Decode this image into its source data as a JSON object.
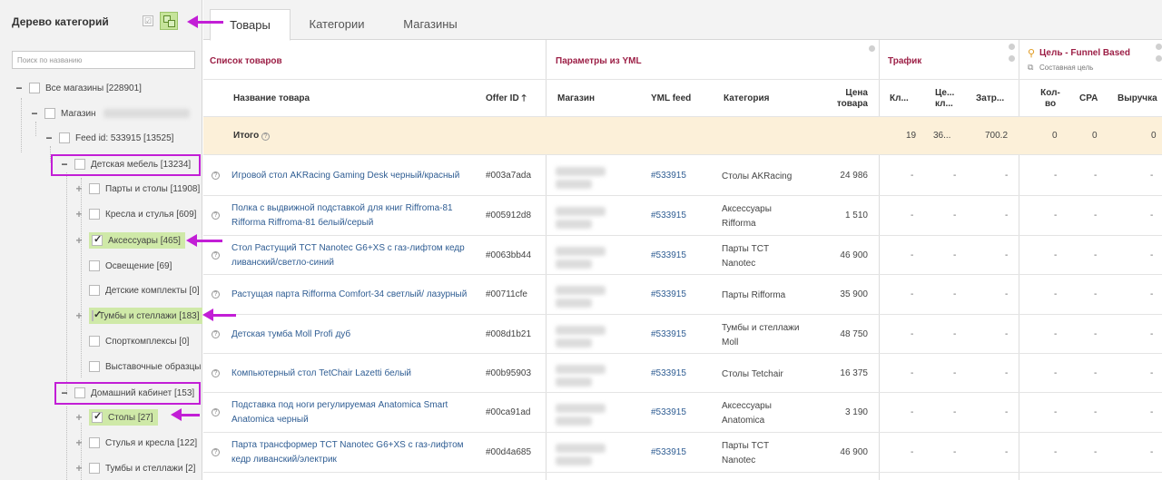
{
  "sidebar": {
    "title": "Дерево категорий",
    "search_placeholder": "Поиск по названию",
    "tree": [
      {
        "label": "Все магазины [228901]"
      },
      {
        "label": "Магазин"
      },
      {
        "label": "Feed id: 533915 [13525]"
      },
      {
        "label": "Детская мебель [13234]"
      },
      {
        "label": "Парты и столы [11908]"
      },
      {
        "label": "Кресла и стулья [609]"
      },
      {
        "label": "Аксессуары [465]"
      },
      {
        "label": "Освещение [69]"
      },
      {
        "label": "Детские комплекты [0]"
      },
      {
        "label": "Тумбы и стеллажи [183]"
      },
      {
        "label": "Спорткомплексы [0]"
      },
      {
        "label": "Выставочные образцы"
      },
      {
        "label": "Домашний кабинет [153]"
      },
      {
        "label": "Столы [27]"
      },
      {
        "label": "Стулья и кресла [122]"
      },
      {
        "label": "Тумбы и стеллажи [2]"
      }
    ]
  },
  "tabs": [
    "Товары",
    "Категории",
    "Магазины"
  ],
  "sections": {
    "products": "Список товаров",
    "yml": "Параметры из YML",
    "traffic": "Трафик",
    "goal": "Цель - Funnel Based",
    "goal_sub": "Составная цель"
  },
  "columns": {
    "name": "Название товара",
    "offer": "Offer ID",
    "shop": "Магазин",
    "feed": "YML feed",
    "category": "Категория",
    "price": "Цена товара",
    "clicks": "Кл...",
    "cpc": "Це... кл...",
    "cost": "Затр...",
    "qty": "Кол-во",
    "cpa": "CPA",
    "revenue": "Выручка"
  },
  "totals": {
    "label": "Итого",
    "clicks": "19",
    "cpc": "36...",
    "cost": "700.2",
    "qty": "0",
    "cpa": "0",
    "revenue": "0"
  },
  "rows": [
    {
      "name": "Игровой стол AKRacing Gaming Desk черный/красный",
      "offer": "#003a7ada",
      "feed": "#533915",
      "category": "Столы AKRacing",
      "price": "24 986"
    },
    {
      "name": "Полка с выдвижной подставкой для книг Riffroma-81 Rifforma Riffroma-81 белый/серый",
      "offer": "#005912d8",
      "feed": "#533915",
      "category": "Аксессуары Rifforma",
      "price": "1 510"
    },
    {
      "name": "Стол Растущий TCT Nanotec G6+XS с газ-лифтом кедр ливанский/светло-синий",
      "offer": "#0063bb44",
      "feed": "#533915",
      "category": "Парты TCT Nanotec",
      "price": "46 900"
    },
    {
      "name": "Растущая парта Rifforma Comfort-34 светлый/ лазурный",
      "offer": "#00711cfe",
      "feed": "#533915",
      "category": "Парты Rifforma",
      "price": "35 900"
    },
    {
      "name": "Детская тумба Moll Profi дуб",
      "offer": "#008d1b21",
      "feed": "#533915",
      "category": "Тумбы и стеллажи Moll",
      "price": "48 750"
    },
    {
      "name": "Компьютерный стол TetChair Lazetti белый",
      "offer": "#00b95903",
      "feed": "#533915",
      "category": "Столы Tetchair",
      "price": "16 375"
    },
    {
      "name": "Подставка под ноги регулируемая Anatomica Smart Anatomica черный",
      "offer": "#00ca91ad",
      "feed": "#533915",
      "category": "Аксессуары Anatomica",
      "price": "3 190"
    },
    {
      "name": "Парта трансформер TCT Nanotec G6+XS с газ-лифтом кедр ливанский/электрик",
      "offer": "#00d4a685",
      "feed": "#533915",
      "category": "Парты TCT Nanotec",
      "price": "46 900"
    }
  ],
  "dash": "-",
  "colors": {
    "accent": "#c21ed6",
    "highlight": "#cfe9a8",
    "section": "#9c1f46",
    "link": "#2f5d93"
  }
}
